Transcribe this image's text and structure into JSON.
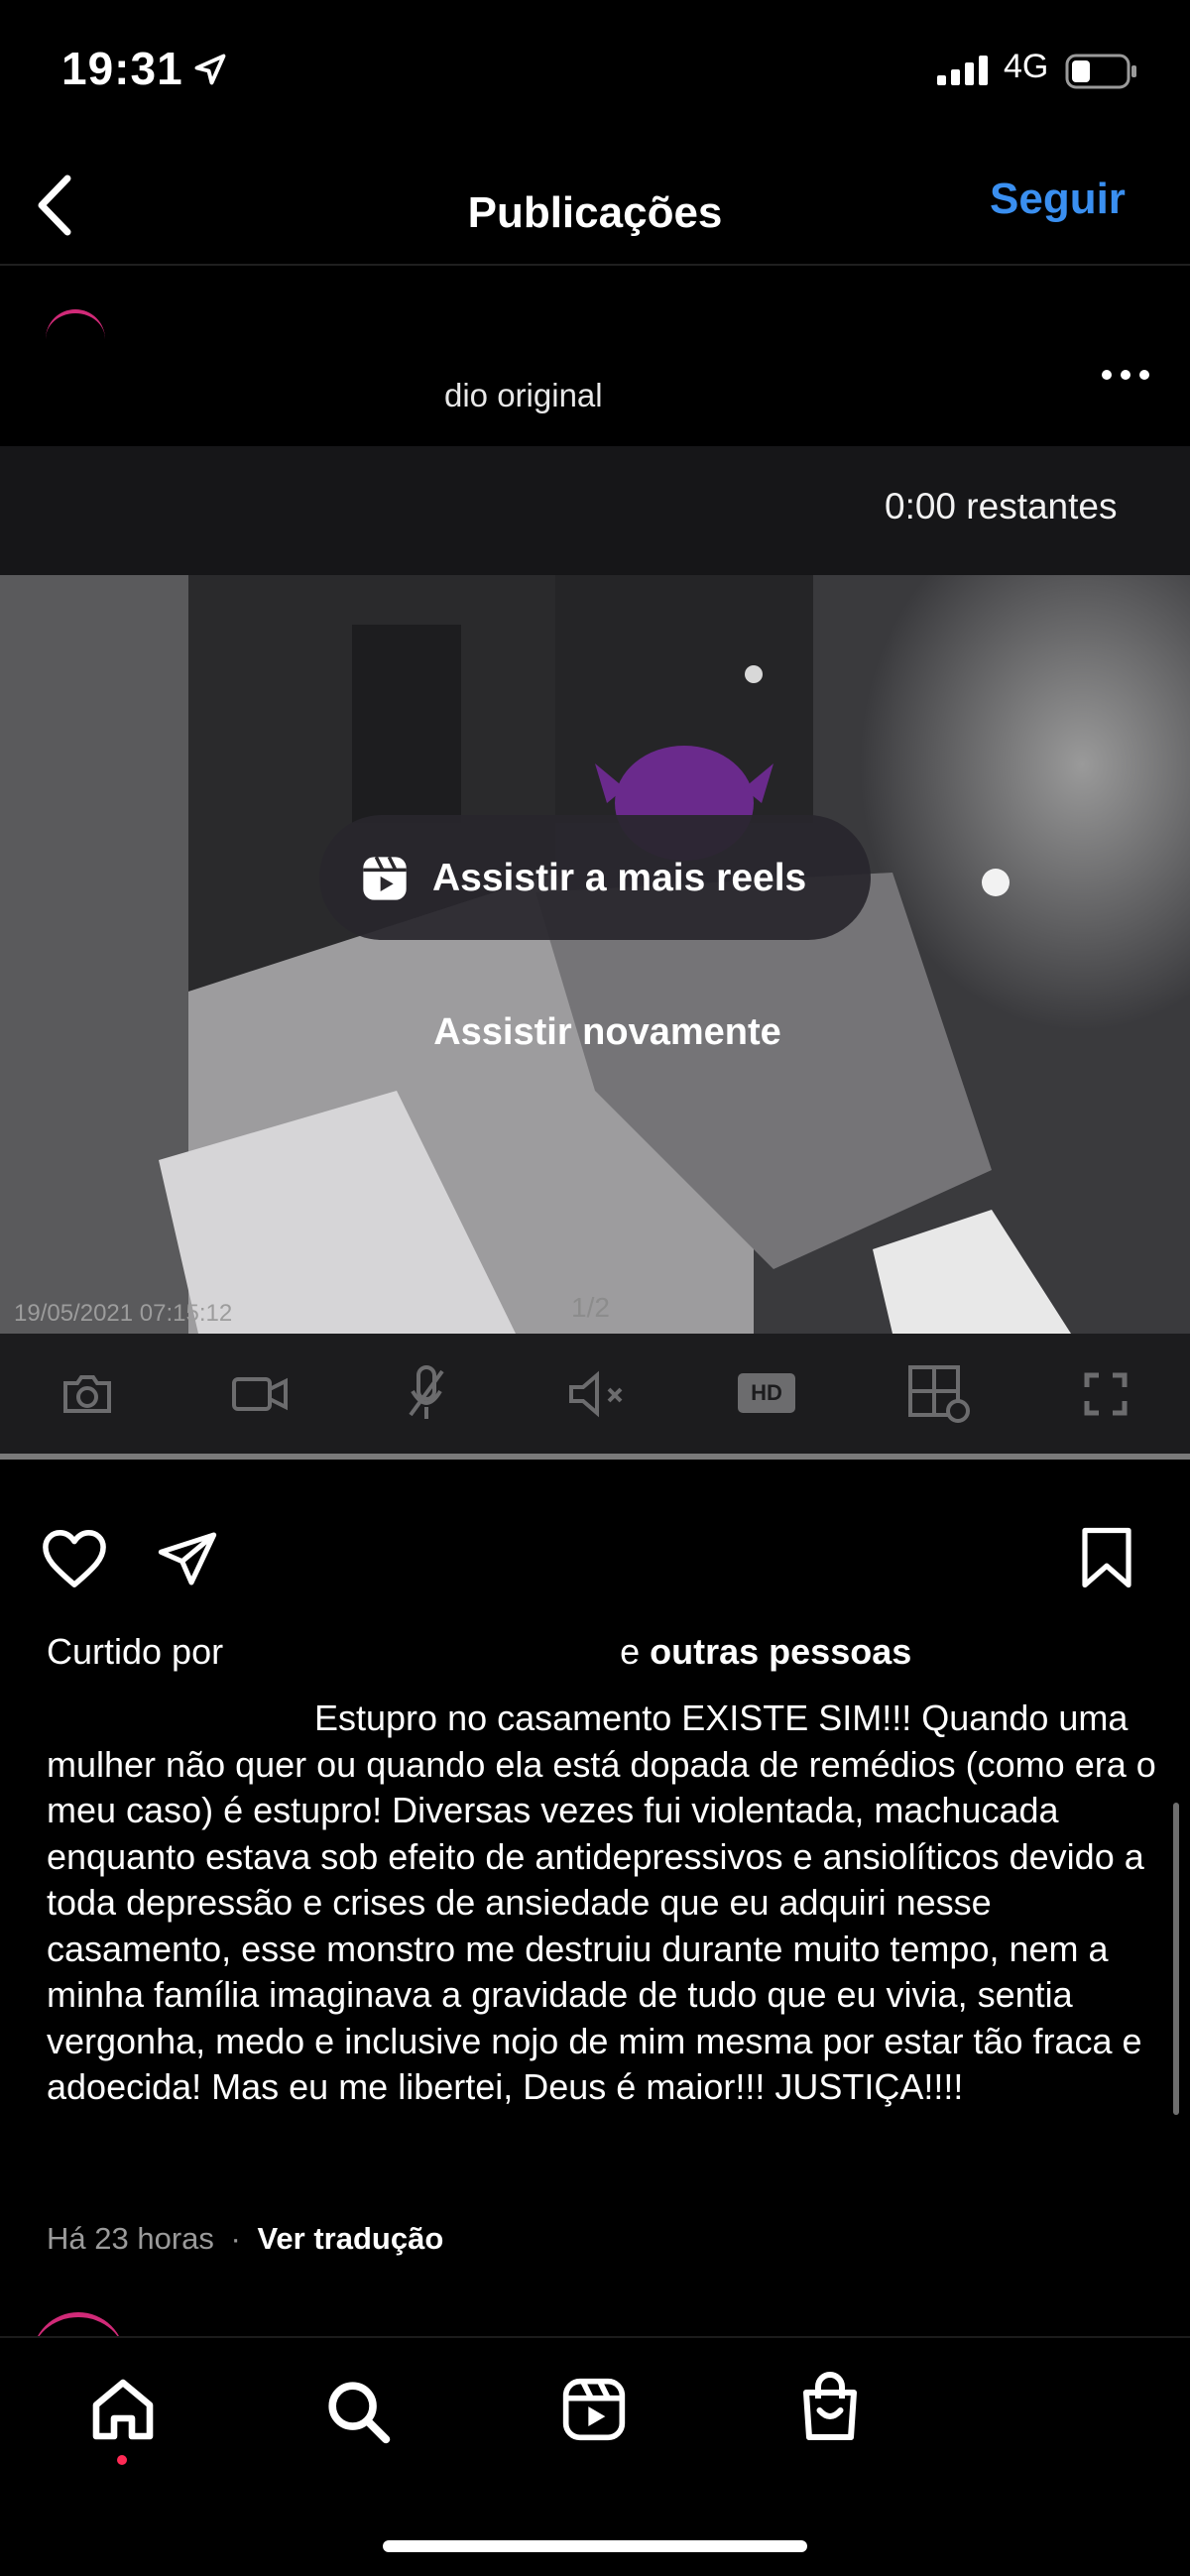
{
  "status_bar": {
    "time": "19:31",
    "network": "4G"
  },
  "header": {
    "title": "Publicações",
    "follow_label": "Seguir"
  },
  "post": {
    "audio_label": "dio original",
    "video": {
      "remaining": "0:00 restantes",
      "more_reels_label": "Assistir a mais reels",
      "replay_label": "Assistir novamente",
      "timestamp": "19/05/2021 07:15:12",
      "page_indicator": "1/2",
      "quality_label": "HD"
    },
    "liked_by_prefix": "Curtido por",
    "liked_by_suffix_connector": "e",
    "liked_by_suffix": "outras pessoas",
    "caption": "Estupro no casamento EXISTE SIM!!! Quando uma mulher não quer ou quando ela está dopada de remédios (como era o meu caso) é estupro! Diversas vezes fui violentada, machucada enquanto estava sob efeito de antidepressivos e ansiolíticos devido a toda depressão e crises de ansiedade que eu adquiri nesse casamento, esse monstro me destruiu durante muito tempo, nem a minha família imaginava a gravidade de tudo que eu vivia, sentia vergonha, medo e inclusive nojo de mim mesma por estar tão fraca e adoecida! Mas eu me libertei, Deus é maior!!! JUSTIÇA!!!!",
    "time_ago": "Há 23 horas",
    "separator": "·",
    "translate_label": "Ver tradução"
  },
  "colors": {
    "accent": "#3a8ff0",
    "background": "#000000",
    "muted": "#9a9a9a",
    "notification_dot": "#ff2a55"
  },
  "icons": [
    "location-arrow-icon",
    "signal-icon",
    "battery-icon",
    "back-chevron-icon",
    "more-icon",
    "reels-icon",
    "camera-icon",
    "video-icon",
    "mic-off-icon",
    "speaker-mute-icon",
    "grid-icon",
    "fullscreen-icon",
    "heart-icon",
    "share-icon",
    "bookmark-icon",
    "home-icon",
    "search-icon",
    "reels-tab-icon",
    "shop-icon"
  ]
}
